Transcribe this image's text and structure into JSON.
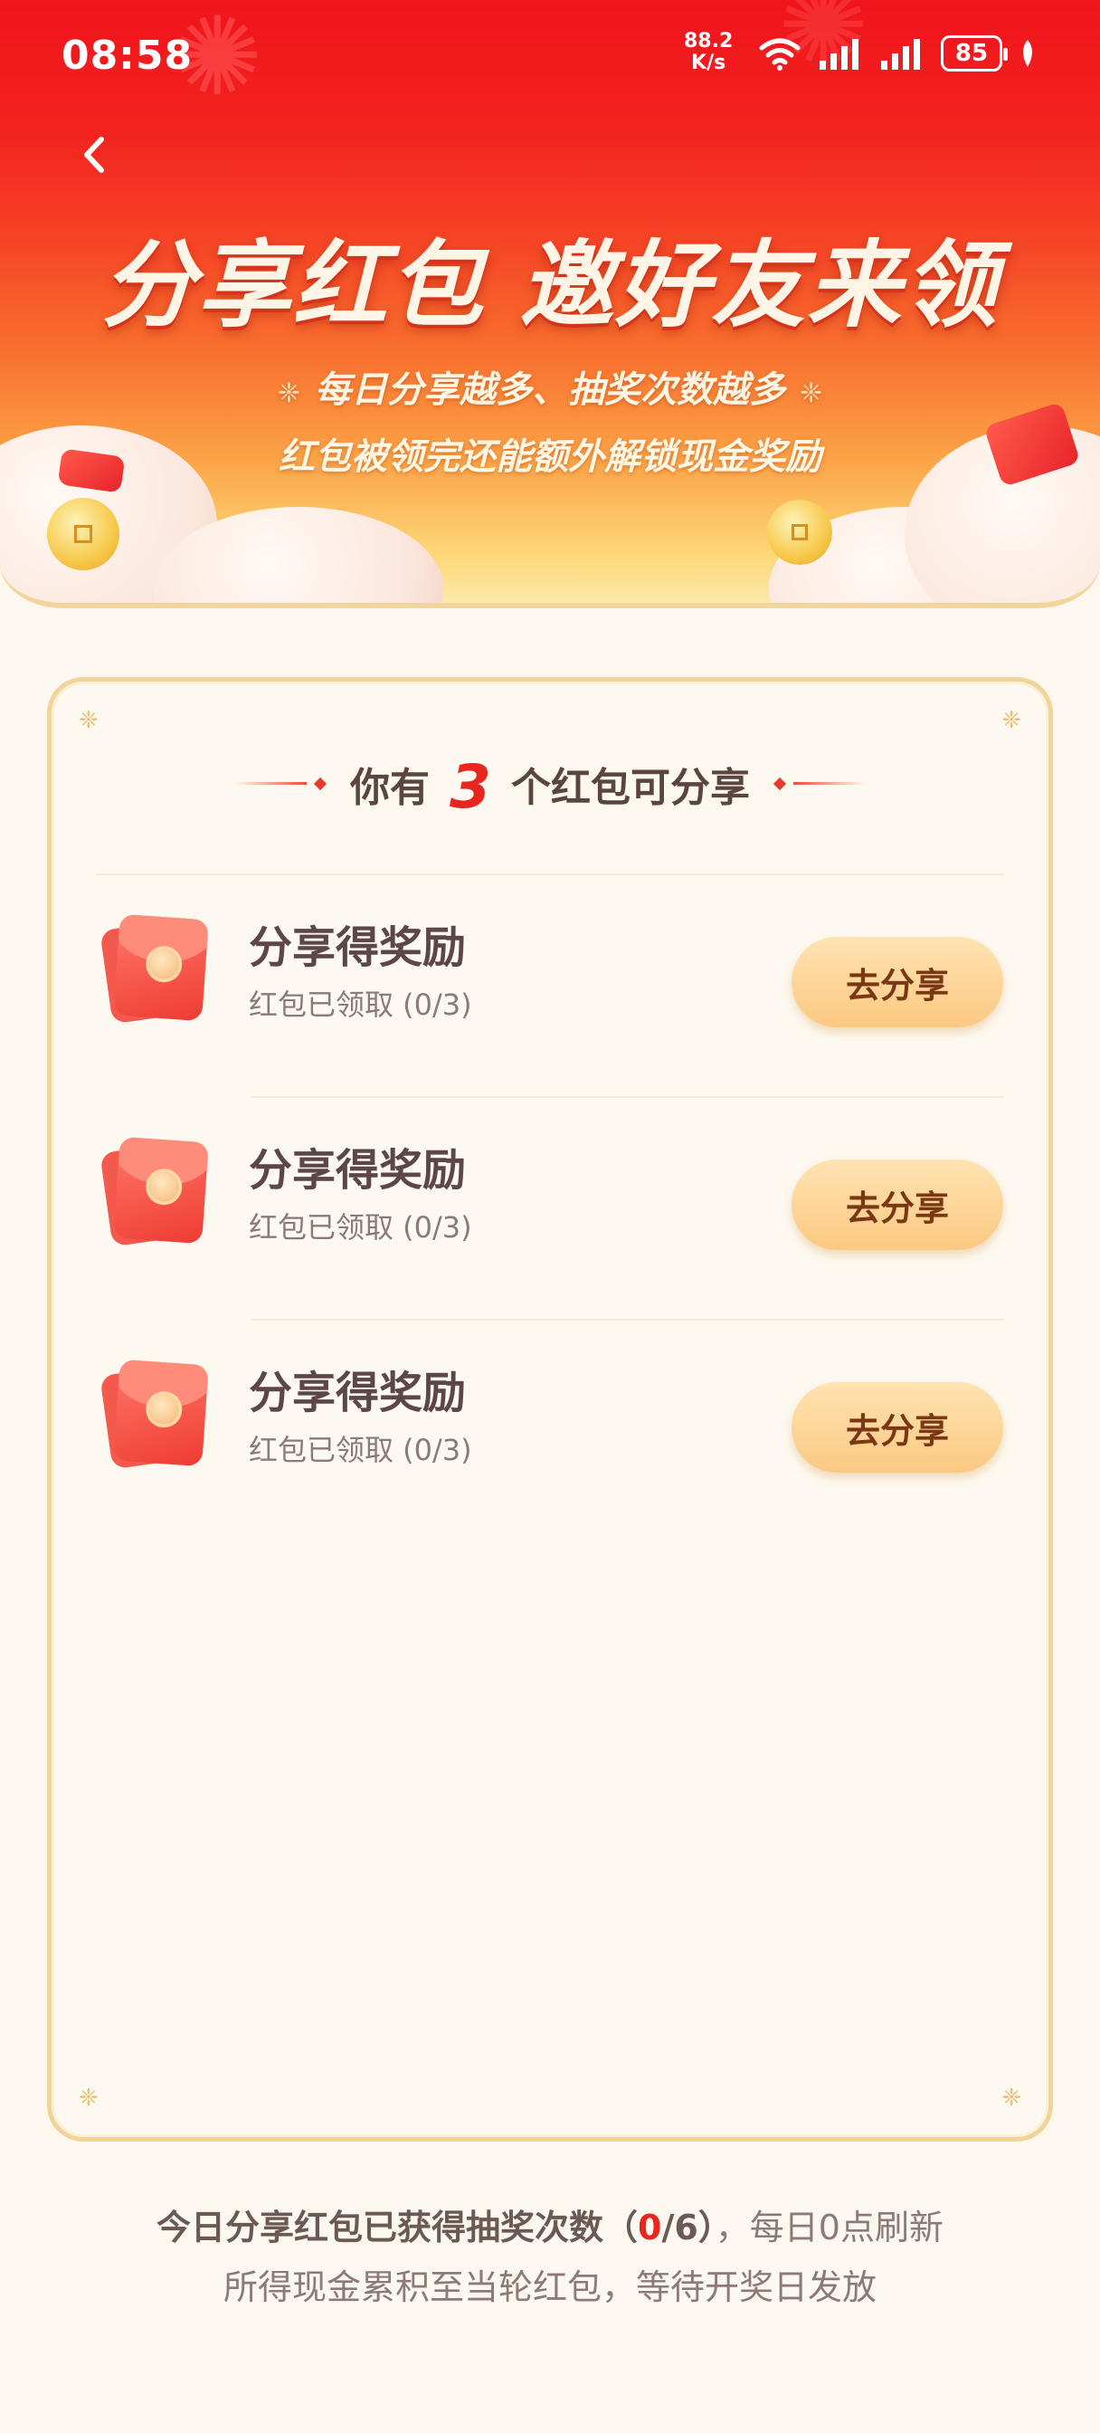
{
  "status_bar": {
    "time": "08:58",
    "speed_value": "88.2",
    "speed_unit": "K/s",
    "battery": "85"
  },
  "banner": {
    "title": "分享红包 邀好友来领",
    "subtitle_line1": "每日分享越多、抽奖次数越多",
    "subtitle_line2": "红包被领完还能额外解锁现金奖励"
  },
  "card": {
    "heading_prefix": "你有",
    "heading_count": "3",
    "heading_suffix": "个红包可分享",
    "items": [
      {
        "title": "分享得奖励",
        "status": "红包已领取 (0/3)",
        "button": "去分享"
      },
      {
        "title": "分享得奖励",
        "status": "红包已领取 (0/3)",
        "button": "去分享"
      },
      {
        "title": "分享得奖励",
        "status": "红包已领取 (0/3)",
        "button": "去分享"
      }
    ]
  },
  "footer": {
    "line1_prefix": "今日分享红包已获得抽奖次数（",
    "line1_count": "0",
    "line1_total": "/6）",
    "line1_suffix": "，每日0点刷新",
    "line2": "所得现金累积至当轮红包，等待开奖日发放"
  },
  "colors": {
    "banner_top": "#f0141c",
    "accent_red": "#e8261f",
    "button_bg": "#fcc982",
    "card_border": "#f0d49a",
    "page_bg": "#fdf8ef"
  }
}
